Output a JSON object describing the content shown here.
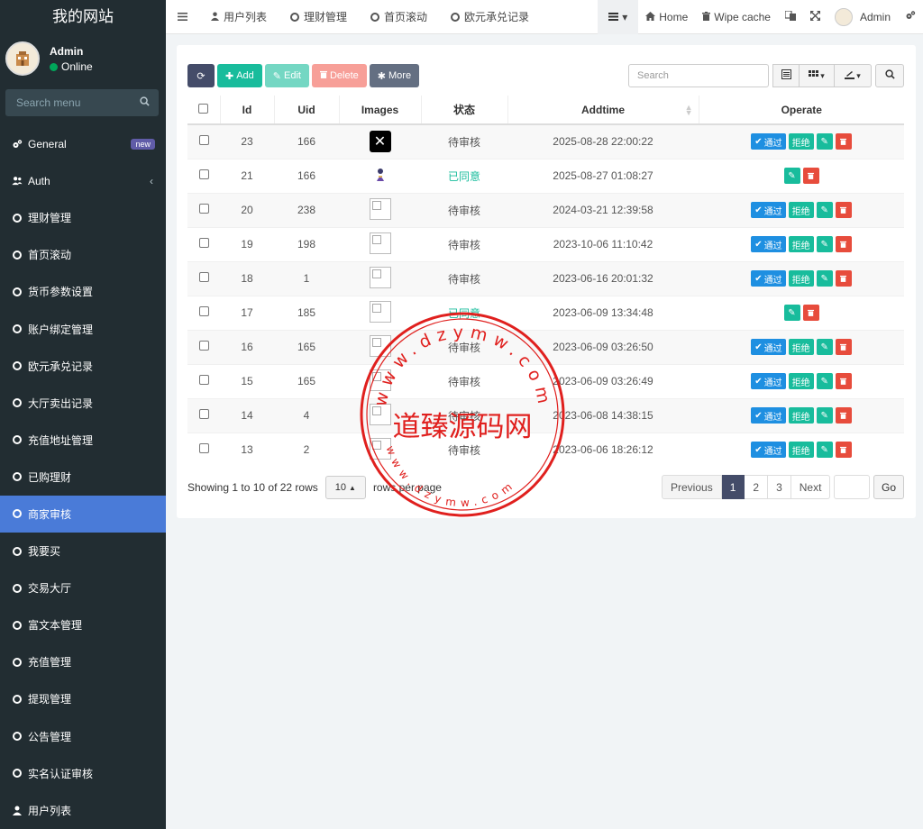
{
  "app": {
    "title": "我的网站"
  },
  "user": {
    "name": "Admin",
    "status": "Online"
  },
  "sidebar": {
    "search_placeholder": "Search menu",
    "items": [
      {
        "label": "General",
        "badge": "new"
      },
      {
        "label": "Auth"
      },
      {
        "label": "理财管理"
      },
      {
        "label": "首页滚动"
      },
      {
        "label": "货币参数设置"
      },
      {
        "label": "账户绑定管理"
      },
      {
        "label": "欧元承兑记录"
      },
      {
        "label": "大厅卖出记录"
      },
      {
        "label": "充值地址管理"
      },
      {
        "label": "已购理财"
      },
      {
        "label": "商家审核"
      },
      {
        "label": "我要买"
      },
      {
        "label": "交易大厅"
      },
      {
        "label": "富文本管理"
      },
      {
        "label": "充值管理"
      },
      {
        "label": "提现管理"
      },
      {
        "label": "公告管理"
      },
      {
        "label": "实名认证审核"
      },
      {
        "label": "用户列表"
      }
    ]
  },
  "topbar": {
    "tabs": [
      "用户列表",
      "理财管理",
      "首页滚动",
      "欧元承兑记录"
    ],
    "home": "Home",
    "wipe": "Wipe cache",
    "admin": "Admin"
  },
  "toolbar": {
    "add": "Add",
    "edit": "Edit",
    "delete": "Delete",
    "more": "More",
    "search_placeholder": "Search"
  },
  "table": {
    "headers": [
      "Id",
      "Uid",
      "Images",
      "状态",
      "Addtime",
      "Operate"
    ],
    "approve_label": "通过",
    "reject_label": "拒绝",
    "rows": [
      {
        "id": "23",
        "uid": "166",
        "image": "x",
        "status": "待审核",
        "addtime": "2025-08-28 22:00:22",
        "pending": true
      },
      {
        "id": "21",
        "uid": "166",
        "image": "figure",
        "status": "已同意",
        "addtime": "2025-08-27 01:08:27",
        "pending": false
      },
      {
        "id": "20",
        "uid": "238",
        "image": "broken",
        "status": "待审核",
        "addtime": "2024-03-21 12:39:58",
        "pending": true
      },
      {
        "id": "19",
        "uid": "198",
        "image": "broken",
        "status": "待审核",
        "addtime": "2023-10-06 11:10:42",
        "pending": true
      },
      {
        "id": "18",
        "uid": "1",
        "image": "broken",
        "status": "待审核",
        "addtime": "2023-06-16 20:01:32",
        "pending": true
      },
      {
        "id": "17",
        "uid": "185",
        "image": "broken",
        "status": "已同意",
        "addtime": "2023-06-09 13:34:48",
        "pending": false
      },
      {
        "id": "16",
        "uid": "165",
        "image": "broken",
        "status": "待审核",
        "addtime": "2023-06-09 03:26:50",
        "pending": true
      },
      {
        "id": "15",
        "uid": "165",
        "image": "broken",
        "status": "待审核",
        "addtime": "2023-06-09 03:26:49",
        "pending": true
      },
      {
        "id": "14",
        "uid": "4",
        "image": "broken",
        "status": "待审核",
        "addtime": "2023-06-08 14:38:15",
        "pending": true
      },
      {
        "id": "13",
        "uid": "2",
        "image": "broken",
        "status": "待审核",
        "addtime": "2023-06-06 18:26:12",
        "pending": true
      }
    ]
  },
  "pagination": {
    "showing": "Showing 1 to 10 of 22 rows",
    "page_size": "10",
    "rows_per_page": "rows per page",
    "previous": "Previous",
    "pages": [
      "1",
      "2",
      "3"
    ],
    "next": "Next",
    "go": "Go"
  },
  "watermark": {
    "text": "道臻源码网",
    "url_top": "www.dzymw.com",
    "url_bottom": "www.dzymw.com",
    "color": "#e0201e"
  }
}
